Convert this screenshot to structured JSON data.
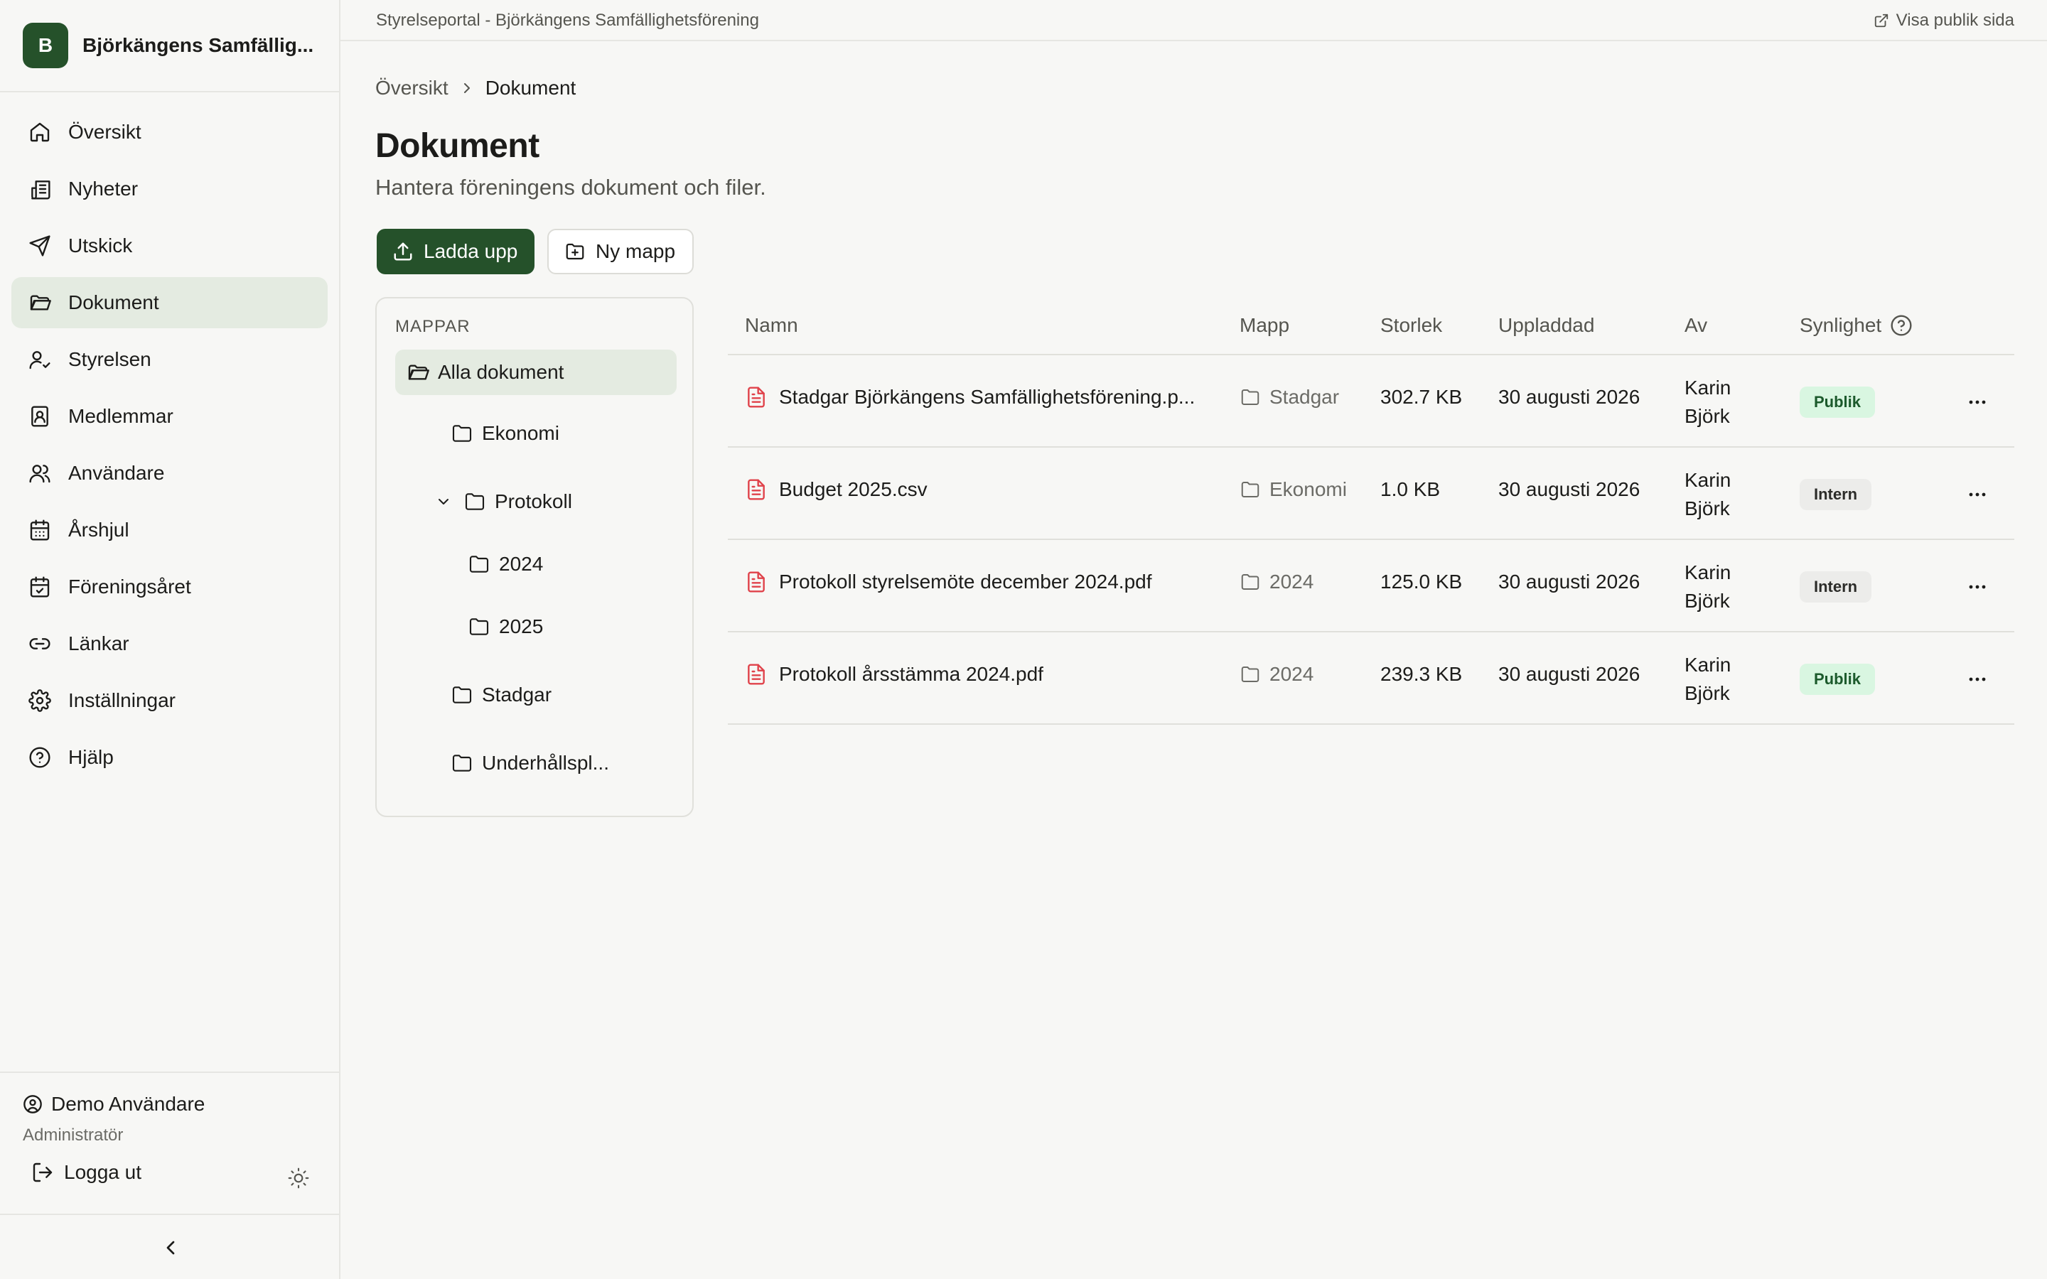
{
  "brand": {
    "logo_letter": "B",
    "name": "Björkängens Samfällig..."
  },
  "nav": [
    {
      "label": "Översikt",
      "icon": "home-icon"
    },
    {
      "label": "Nyheter",
      "icon": "newspaper-icon"
    },
    {
      "label": "Utskick",
      "icon": "send-icon"
    },
    {
      "label": "Dokument",
      "icon": "folder-open-icon",
      "active": true
    },
    {
      "label": "Styrelsen",
      "icon": "user-check-icon"
    },
    {
      "label": "Medlemmar",
      "icon": "contact-book-icon"
    },
    {
      "label": "Användare",
      "icon": "users-icon"
    },
    {
      "label": "Årshjul",
      "icon": "calendar-grid-icon"
    },
    {
      "label": "Föreningsåret",
      "icon": "calendar-check-icon"
    },
    {
      "label": "Länkar",
      "icon": "link-icon"
    },
    {
      "label": "Inställningar",
      "icon": "gear-icon"
    },
    {
      "label": "Hjälp",
      "icon": "help-circle-icon"
    }
  ],
  "user": {
    "name": "Demo Användare",
    "role": "Administratör",
    "logout_label": "Logga ut"
  },
  "topbar": {
    "title": "Styrelseportal - Björkängens Samfällighetsförening",
    "public_link": "Visa publik sida"
  },
  "breadcrumb": {
    "parent": "Översikt",
    "current": "Dokument"
  },
  "page": {
    "title": "Dokument",
    "subtitle": "Hantera föreningens dokument och filer."
  },
  "actions": {
    "upload": "Ladda upp",
    "new_folder": "Ny mapp"
  },
  "folders": {
    "heading": "MAPPAR",
    "all": "Alla dokument",
    "items": [
      "Ekonomi",
      "Protokoll",
      "2024",
      "2025",
      "Stadgar",
      "Underhållspl..."
    ]
  },
  "table": {
    "headers": {
      "name": "Namn",
      "folder": "Mapp",
      "size": "Storlek",
      "uploaded": "Uppladdad",
      "by": "Av",
      "visibility": "Synlighet"
    },
    "rows": [
      {
        "name": "Stadgar Björkängens Samfällighetsförening.p...",
        "folder": "Stadgar",
        "size": "302.7 KB",
        "date": "30 augusti 2026",
        "by_first": "Karin",
        "by_last": "Björk",
        "visibility": "Publik"
      },
      {
        "name": "Budget 2025.csv",
        "folder": "Ekonomi",
        "size": "1.0 KB",
        "date": "30 augusti 2026",
        "by_first": "Karin",
        "by_last": "Björk",
        "visibility": "Intern"
      },
      {
        "name": "Protokoll styrelsemöte december 2024.pdf",
        "folder": "2024",
        "size": "125.0 KB",
        "date": "30 augusti 2026",
        "by_first": "Karin",
        "by_last": "Björk",
        "visibility": "Intern"
      },
      {
        "name": "Protokoll årsstämma 2024.pdf",
        "folder": "2024",
        "size": "239.3 KB",
        "date": "30 augusti 2026",
        "by_first": "Karin",
        "by_last": "Björk",
        "visibility": "Publik"
      }
    ]
  },
  "colors": {
    "brand": "#25512a",
    "active_bg": "#e4ebe1",
    "file_icon": "#e0424a",
    "publik_bg": "#d9f6e1",
    "intern_bg": "#ececea"
  }
}
